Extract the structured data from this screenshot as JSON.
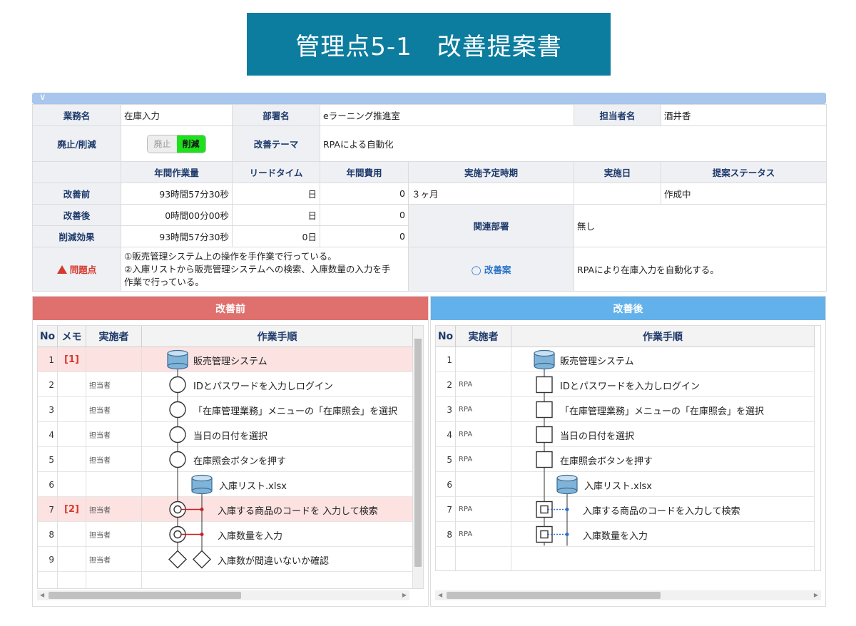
{
  "title": "管理点5-1　改善提案書",
  "info": {
    "job_label": "業務名",
    "job_value": "在庫入力",
    "dept_label": "部署名",
    "dept_value": "eラーニング推進室",
    "owner_label": "担当者名",
    "owner_value": "酒井香",
    "abolish_label": "廃止/削減",
    "toggle_off": "廃止",
    "toggle_on": "削減",
    "theme_label": "改善テーマ",
    "theme_value": "RPAによる自動化",
    "col_annual": "年間作業量",
    "col_lead": "リードタイム",
    "col_cost": "年間費用",
    "col_planned": "実施予定時期",
    "col_done": "実施日",
    "col_status": "提案ステータス",
    "before_label": "改善前",
    "before_annual": "93時間57分30秒",
    "before_lead": "日",
    "before_cost": "0",
    "planned_value": "３ヶ月",
    "status_value": "作成中",
    "after_label": "改善後",
    "after_annual": "0時間00分00秒",
    "after_lead": "日",
    "after_cost": "0",
    "related_label": "関連部署",
    "related_value": "無し",
    "effect_label": "削減効果",
    "effect_annual": "93時間57分30秒",
    "effect_lead": "0日",
    "effect_cost": "0",
    "problem_label": "問題点",
    "problem_line1": "①販売管理システム上の操作を手作業で行っている。",
    "problem_line2": "②入庫リストから販売管理システムへの検索、入庫数量の入力を手",
    "problem_line3": "作業で行っている。",
    "proposal_label": "改善案",
    "proposal_value": "RPAにより在庫入力を自動化する。"
  },
  "before_panel": {
    "title": "改善前",
    "headers": {
      "no": "No",
      "memo": "メモ",
      "actor": "実施者",
      "steps": "作業手順"
    },
    "rows": [
      {
        "no": "1",
        "memo": "[1]",
        "actor": "",
        "step": "販売管理システム"
      },
      {
        "no": "2",
        "memo": "",
        "actor": "担当者",
        "step": "IDとパスワードを入力しログイン"
      },
      {
        "no": "3",
        "memo": "",
        "actor": "担当者",
        "step": "「在庫管理業務」メニューの「在庫照会」を選択"
      },
      {
        "no": "4",
        "memo": "",
        "actor": "担当者",
        "step": "当日の日付を選択"
      },
      {
        "no": "5",
        "memo": "",
        "actor": "担当者",
        "step": "在庫照会ボタンを押す"
      },
      {
        "no": "6",
        "memo": "",
        "actor": "",
        "step": "入庫リスト.xlsx"
      },
      {
        "no": "7",
        "memo": "[2]",
        "actor": "担当者",
        "step": "入庫する商品のコードを 入力して検索"
      },
      {
        "no": "8",
        "memo": "",
        "actor": "担当者",
        "step": "入庫数量を入力"
      },
      {
        "no": "9",
        "memo": "",
        "actor": "担当者",
        "step": "入庫数が間違いないか確認"
      }
    ]
  },
  "after_panel": {
    "title": "改善後",
    "headers": {
      "no": "No",
      "actor": "実施者",
      "steps": "作業手順"
    },
    "rows": [
      {
        "no": "1",
        "actor": "",
        "step": "販売管理システム"
      },
      {
        "no": "2",
        "actor": "RPA",
        "step": "IDとパスワードを入力しログイン"
      },
      {
        "no": "3",
        "actor": "RPA",
        "step": "「在庫管理業務」メニューの「在庫照会」を選択"
      },
      {
        "no": "4",
        "actor": "RPA",
        "step": "当日の日付を選択"
      },
      {
        "no": "5",
        "actor": "RPA",
        "step": "在庫照会ボタンを押す"
      },
      {
        "no": "6",
        "actor": "",
        "step": "入庫リスト.xlsx"
      },
      {
        "no": "7",
        "actor": "RPA",
        "step": "入庫する商品のコードを入力して検索"
      },
      {
        "no": "8",
        "actor": "RPA",
        "step": "入庫数量を入力"
      }
    ]
  },
  "colors": {
    "banner": "#0c7d9f",
    "before_header": "#e0706d",
    "after_header": "#62b1ea",
    "highlight_row": "#fde2e2"
  }
}
